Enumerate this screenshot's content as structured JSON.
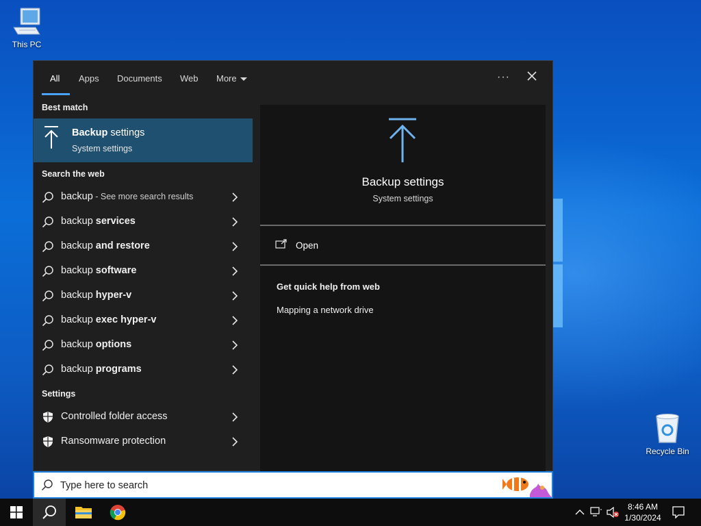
{
  "desktop": {
    "icons": [
      {
        "label": "This PC"
      },
      {
        "label": "Recycle Bin"
      }
    ]
  },
  "search": {
    "tabs": [
      "All",
      "Apps",
      "Documents",
      "Web",
      "More"
    ],
    "active_tab": "All",
    "best_match_header": "Best match",
    "best_match": {
      "title_bold": "Backup",
      "title_rest": " settings",
      "subtitle": "System settings"
    },
    "web_header": "Search the web",
    "web_results": [
      {
        "plain": "backup",
        "bold": "",
        "suffix": " - See more search results"
      },
      {
        "plain": "backup ",
        "bold": "services",
        "suffix": ""
      },
      {
        "plain": "backup ",
        "bold": "and restore",
        "suffix": ""
      },
      {
        "plain": "backup ",
        "bold": "software",
        "suffix": ""
      },
      {
        "plain": "backup ",
        "bold": "hyper-v",
        "suffix": ""
      },
      {
        "plain": "backup ",
        "bold": "exec hyper-v",
        "suffix": ""
      },
      {
        "plain": "backup ",
        "bold": "options",
        "suffix": ""
      },
      {
        "plain": "backup ",
        "bold": "programs",
        "suffix": ""
      }
    ],
    "settings_header": "Settings",
    "settings_results": [
      "Controlled folder access",
      "Ransomware protection"
    ],
    "preview": {
      "title": "Backup settings",
      "subtitle": "System settings",
      "open_label": "Open",
      "quick_help_title": "Get quick help from web",
      "quick_help_links": [
        "Mapping a network drive"
      ]
    },
    "input_placeholder": "Type here to search"
  },
  "taskbar": {
    "time": "8:46 AM",
    "date": "1/30/2024",
    "pinned": [
      "windows-start",
      "search",
      "file-explorer",
      "chrome"
    ]
  },
  "colors": {
    "accent": "#4aa3ff",
    "best_match_bg": "#20506f",
    "panel_bg": "#1f1f1f",
    "preview_bg": "#141414"
  }
}
